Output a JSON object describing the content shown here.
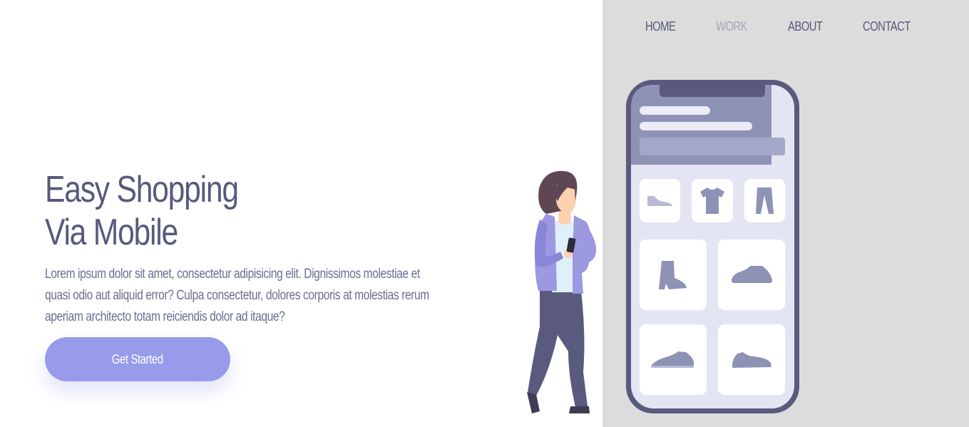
{
  "nav": {
    "items": [
      {
        "label": "HOME",
        "active": false
      },
      {
        "label": "WORK",
        "active": true
      },
      {
        "label": "ABOUT",
        "active": false
      },
      {
        "label": "CONTACT",
        "active": false
      }
    ]
  },
  "hero": {
    "title_line1": "Easy Shopping",
    "title_line2": "Via Mobile",
    "description": "Lorem ipsum dolor sit amet, consectetur adipisicing elit. Dignissimos molestiae et quasi odio aut aliquid error? Culpa consectetur, dolores corporis at molestias rerum aperiam architecto totam reiciendis dolor ad itaque?",
    "cta_label": "Get Started"
  },
  "illustration": {
    "phone_icons": [
      "shoe-icon",
      "tshirt-icon",
      "pants-icon",
      "boot-icon",
      "sneaker-icon",
      "loafer-icon",
      "running-shoe-icon"
    ],
    "person": "woman-holding-phone"
  },
  "colors": {
    "panel_background": "#dcdcdc",
    "text_primary": "#575a7b",
    "text_secondary": "#6b6f8f",
    "nav_active": "#a6a8ba",
    "button_background": "#979bea",
    "button_text": "#ffffff",
    "phone_frame": "#5a5a7e",
    "phone_header": "#8e93b5",
    "phone_screen": "#e4e5f3",
    "product_icon": "#8e93b5",
    "jacket": "#9d98e2",
    "pants": "#5a5a7e",
    "hair": "#5f4654",
    "skin": "#fcd1b0"
  }
}
